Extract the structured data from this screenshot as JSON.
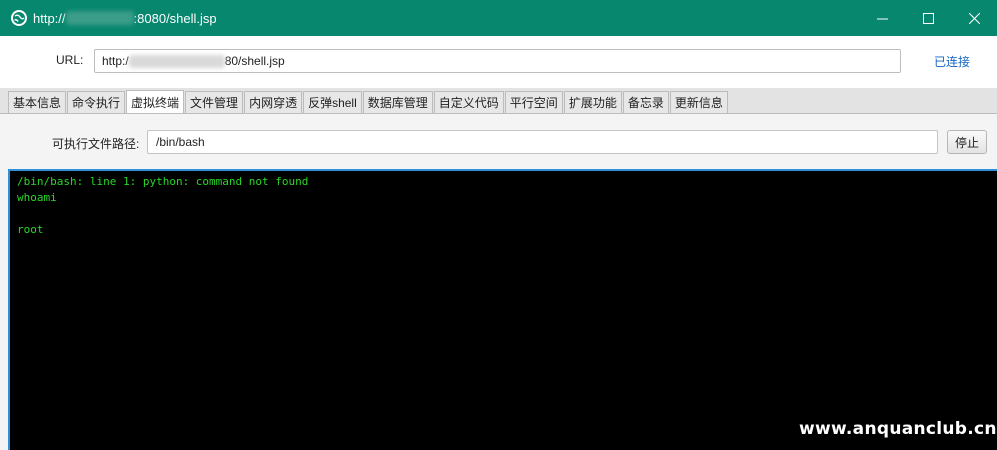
{
  "window": {
    "title_prefix": "http://",
    "title_suffix": ":8080/shell.jsp",
    "minimize_label": "—",
    "maximize_label": "☐",
    "close_label": "✕"
  },
  "url_bar": {
    "label": "URL:",
    "value_prefix": "http:/",
    "value_suffix": "80/shell.jsp",
    "status": "已连接"
  },
  "tabs": [
    {
      "label": "基本信息",
      "active": false
    },
    {
      "label": "命令执行",
      "active": false
    },
    {
      "label": "虚拟终端",
      "active": true
    },
    {
      "label": "文件管理",
      "active": false
    },
    {
      "label": "内网穿透",
      "active": false
    },
    {
      "label": "反弹shell",
      "active": false
    },
    {
      "label": "数据库管理",
      "active": false
    },
    {
      "label": "自定义代码",
      "active": false
    },
    {
      "label": "平行空间",
      "active": false
    },
    {
      "label": "扩展功能",
      "active": false
    },
    {
      "label": "备忘录",
      "active": false
    },
    {
      "label": "更新信息",
      "active": false
    }
  ],
  "terminal_panel": {
    "path_label": "可执行文件路径:",
    "path_value": "/bin/bash",
    "stop_label": "停止",
    "lines": [
      "/bin/bash: line 1: python: command not found",
      "whoami",
      "",
      "root"
    ]
  },
  "watermark": "www.anquanclub.cn",
  "colors": {
    "titlebar": "#08876f",
    "terminal_bg": "#000000",
    "terminal_text": "#28d728",
    "status_link": "#1565c0",
    "terminal_border": "#2f8fd8"
  }
}
